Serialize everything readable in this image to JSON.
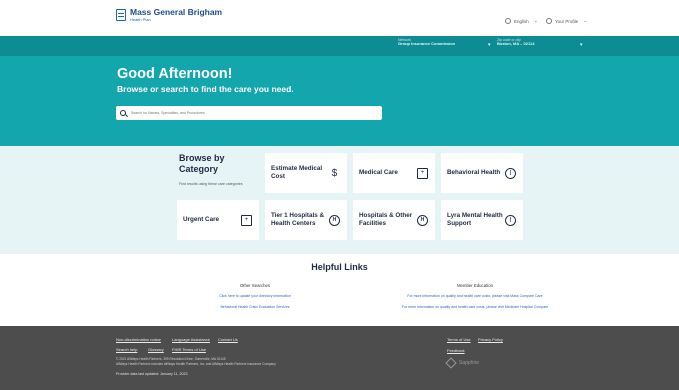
{
  "header": {
    "brand": "Mass General Brigham",
    "brand_sub": "Health Plan",
    "language": "English",
    "profile": "Your Profile"
  },
  "network_bar": {
    "network_label": "Network",
    "network_value": "Group Insurance Commission",
    "location_label": "Zip code or city",
    "location_value": "Boston, MA – 02114"
  },
  "hero": {
    "greeting": "Good Afternoon!",
    "subtitle": "Browse or search to find the care you need.",
    "search_placeholder": "Search for Names, Specialties, and Procedures"
  },
  "categories": {
    "title": "Browse by Category",
    "subtitle": "Find results using these care categories",
    "tiles": [
      {
        "label": "Estimate Medical Cost",
        "icon": "hand-dollar-icon"
      },
      {
        "label": "Medical Care",
        "icon": "hospital-building-icon"
      },
      {
        "label": "Behavioral Health",
        "icon": "brain-icon"
      },
      {
        "label": "Urgent Care",
        "icon": "ambulance-icon"
      },
      {
        "label": "Tier 1 Hospitals & Health Centers",
        "icon": "hospital-h-icon"
      },
      {
        "label": "Hospitals & Other Facilities",
        "icon": "hospital-h-icon"
      },
      {
        "label": "Lyra Mental Health Support",
        "icon": "brain-icon"
      }
    ]
  },
  "helpful_links": {
    "title": "Helpful Links",
    "other_searches": {
      "heading": "Other Searches",
      "links": [
        "Click here to update your directory information",
        "Behavioral Health Crisis Evaluation Services"
      ]
    },
    "member_education": {
      "heading": "Member Education",
      "links": [
        "For more information on quality and health care costs, please visit Mass Compare Care",
        "For more information on quality and health care costs, please visit Medicare Hospital Compare"
      ]
    }
  },
  "footer": {
    "links_row1": [
      "Non-discrimination notice",
      "Language Assistance",
      "Contact Us"
    ],
    "links_row2": [
      "Search help",
      "Glossary",
      "FHIR Terms of Use"
    ],
    "right_links_row1": [
      "Terms of Use",
      "Privacy Policy"
    ],
    "right_links_row2": [
      "Feedback"
    ],
    "copyright_line1": "© 2021 AllWays Health Partners, 399 Revolution Drive, Somerville, MA 02145",
    "copyright_line2": "AllWays Health Partners includes AllWays Health Partners, Inc. and AllWays Health Partners Insurance Company",
    "updated": "Provider data last updated: January 11, 2023",
    "powered_by": "Sapphire"
  },
  "colors": {
    "teal_dark": "#0e8c93",
    "teal": "#13a6ad",
    "category_bg": "#e6f4f6",
    "footer_bg": "#4d4d4d",
    "link": "#2c63c4"
  }
}
